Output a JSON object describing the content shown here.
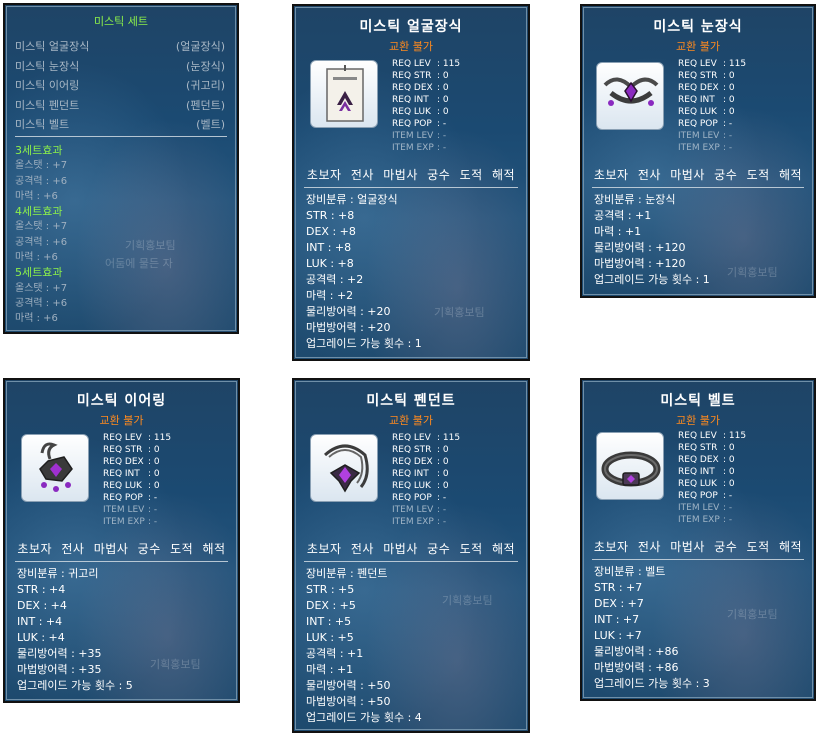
{
  "set_panel": {
    "title": "미스틱 세트",
    "items": [
      {
        "name": "미스틱 얼굴장식",
        "slot": "(얼굴장식)"
      },
      {
        "name": "미스틱 눈장식",
        "slot": "(눈장식)"
      },
      {
        "name": "미스틱 이어링",
        "slot": "(귀고리)"
      },
      {
        "name": "미스틱 펜던트",
        "slot": "(펜던트)"
      },
      {
        "name": "미스틱 벨트",
        "slot": "(벨트)"
      }
    ],
    "effects": [
      {
        "head": "3세트효과",
        "lines": [
          "올스탯 : +7",
          "공격력 : +6",
          "마력 : +6"
        ]
      },
      {
        "head": "4세트효과",
        "lines": [
          "올스탯 : +7",
          "공격력 : +6",
          "마력 : +6"
        ]
      },
      {
        "head": "5세트효과",
        "lines": [
          "올스탯 : +7",
          "공격력 : +6",
          "마력 : +6"
        ]
      }
    ],
    "watermark1": "기획홍보팀",
    "watermark2": "어둠에 물든 자"
  },
  "req_labels": [
    "REQ LEV",
    "REQ STR",
    "REQ DEX",
    "REQ INT",
    "REQ LUK",
    "REQ POP",
    "ITEM LEV",
    "ITEM EXP"
  ],
  "jobs": "초보자 전사 마법사 궁수 도적 해적",
  "trade_label": "교환 불가",
  "watermark": "기획홍보팀",
  "items": [
    {
      "title": "미스틱 얼굴장식",
      "icon": "face-accessory-icon",
      "req_values": [
        ": 115",
        ": 0",
        ": 0",
        ": 0",
        ": 0",
        ": -",
        ": -",
        ": -"
      ],
      "stats": [
        "장비분류 : 얼굴장식",
        "STR : +8",
        "DEX : +8",
        "INT : +8",
        "LUK : +8",
        "공격력 : +2",
        "마력 : +2",
        "물리방어력 : +20",
        "마법방어력 : +20",
        "업그레이드 가능 횟수 : 1"
      ]
    },
    {
      "title": "미스틱 눈장식",
      "icon": "eye-accessory-icon",
      "req_values": [
        ": 115",
        ": 0",
        ": 0",
        ": 0",
        ": 0",
        ": -",
        ": -",
        ": -"
      ],
      "stats": [
        "장비분류 : 눈장식",
        "공격력 : +1",
        "마력 : +1",
        "물리방어력 : +120",
        "마법방어력 : +120",
        "업그레이드 가능 횟수 : 1"
      ]
    },
    {
      "title": "미스틱 이어링",
      "icon": "earring-icon",
      "req_values": [
        ": 115",
        ": 0",
        ": 0",
        ": 0",
        ": 0",
        ": -",
        ": -",
        ": -"
      ],
      "stats": [
        "장비분류 : 귀고리",
        "STR : +4",
        "DEX : +4",
        "INT : +4",
        "LUK : +4",
        "물리방어력 : +35",
        "마법방어력 : +35",
        "업그레이드 가능 횟수 : 5"
      ]
    },
    {
      "title": "미스틱 펜던트",
      "icon": "pendant-icon",
      "req_values": [
        ": 115",
        ": 0",
        ": 0",
        ": 0",
        ": 0",
        ": -",
        ": -",
        ": -"
      ],
      "stats": [
        "장비분류 : 펜던트",
        "STR : +5",
        "DEX : +5",
        "INT : +5",
        "LUK : +5",
        "공격력 : +1",
        "마력 : +1",
        "물리방어력 : +50",
        "마법방어력 : +50",
        "업그레이드 가능 횟수 : 4"
      ]
    },
    {
      "title": "미스틱 벨트",
      "icon": "belt-icon",
      "req_values": [
        ": 115",
        ": 0",
        ": 0",
        ": 0",
        ": 0",
        ": -",
        ": -",
        ": -"
      ],
      "stats": [
        "장비분류 : 벨트",
        "STR : +7",
        "DEX : +7",
        "INT : +7",
        "LUK : +7",
        "물리방어력 : +86",
        "마법방어력 : +86",
        "업그레이드 가능 횟수 : 3"
      ]
    }
  ],
  "colors": {
    "panel_bg": "#1f4a70",
    "trade": "#ff8a1e",
    "set_green": "#8cf04a",
    "dim_text": "#9fb4c6"
  }
}
